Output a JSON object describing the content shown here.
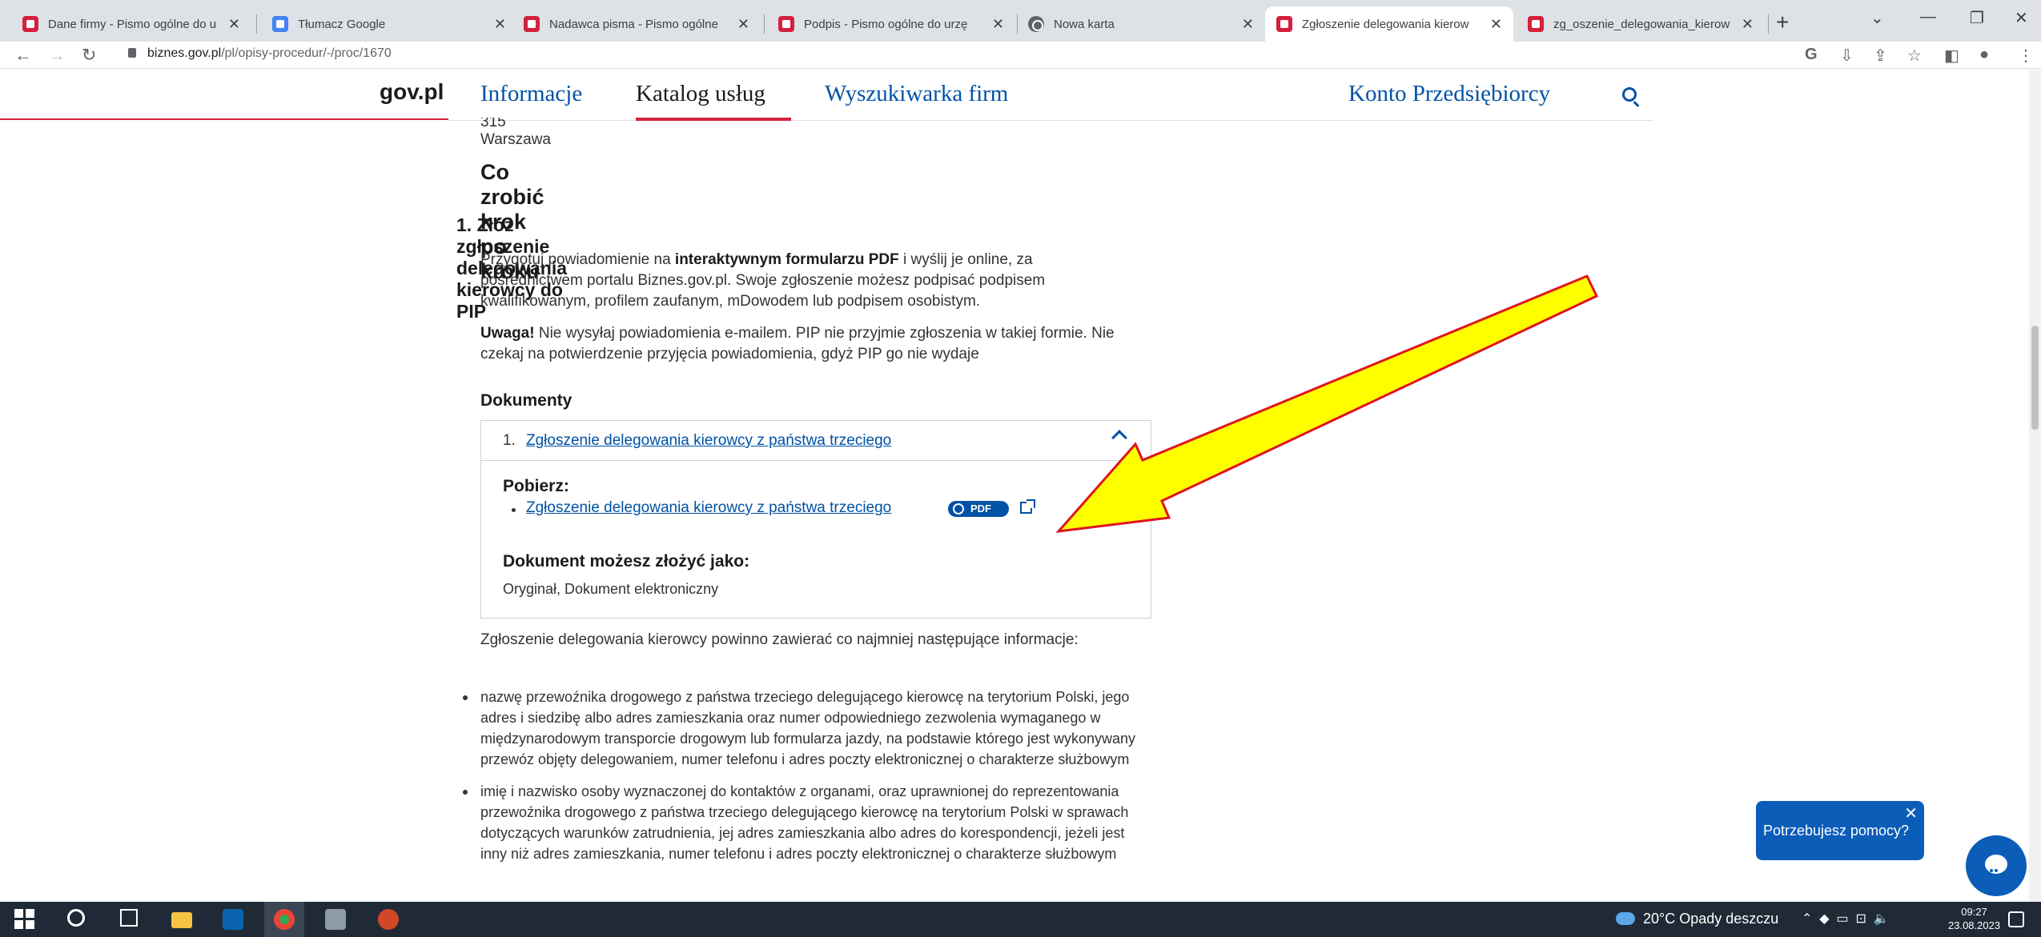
{
  "browser": {
    "tabs": [
      {
        "title": "Dane firmy - Pismo ogólne do u",
        "active": false
      },
      {
        "title": "Tłumacz Google",
        "active": false
      },
      {
        "title": "Nadawca pisma - Pismo ogólne",
        "active": false
      },
      {
        "title": "Podpis - Pismo ogólne do urzę",
        "active": false
      },
      {
        "title": "Nowa karta",
        "active": false
      },
      {
        "title": "Zgłoszenie delegowania kierow",
        "active": true
      },
      {
        "title": "zg_oszenie_delegowania_kierow",
        "active": false
      }
    ],
    "new_tab": "+",
    "close_glyph": "✕",
    "url_domain": "biznes.gov.pl",
    "url_path": "/pl/opisy-procedur/-/proc/1670"
  },
  "header": {
    "logo": "gov.pl",
    "menu": [
      "Informacje",
      "Katalog usług",
      "Wyszukiwarka firm"
    ],
    "account": "Konto Przedsiębiorcy"
  },
  "content": {
    "cut_address": "315 Warszawa",
    "section_title": "Co zrobić krok po kroku",
    "step_title": "1. Złóż zgłoszenie delegowania kierowcy do PIP",
    "p1_before": "Przygotuj powiadomienie na ",
    "p1_bold": "interaktywnym formularzu PDF",
    "p1_after": " i wyślij je online, za pośrednictwem portalu Biznes.gov.pl. Swoje zgłoszenie możesz podpisać podpisem kwalifikowanym, profilem zaufanym, mDowodem lub podpisem osobistym.",
    "p2_bold": "Uwaga!",
    "p2_after": " Nie wysyłaj powiadomienia e-mailem. PIP nie przyjmie zgłoszenia w takiej formie. Nie czekaj na potwierdzenie przyjęcia powiadomienia, gdyż PIP go nie wydaje",
    "docs_title": "Dokumenty",
    "doc": {
      "num": "1.",
      "title": "Zgłoszenie delegowania kierowcy z państwa trzeciego",
      "download_label": "Pobierz:",
      "download_link": "Zgłoszenie delegowania kierowcy z państwa trzeciego",
      "pdf_badge": "PDF",
      "submit_label": "Dokument możesz złożyć jako:",
      "submit_value": "Oryginał, Dokument elektroniczny"
    },
    "info_intro": "Zgłoszenie delegowania kierowcy powinno zawierać co najmniej następujące informacje:",
    "bullets": [
      "nazwę przewoźnika drogowego z państwa trzeciego delegującego kierowcę na terytorium Polski, jego adres i siedzibę albo adres zamieszkania oraz numer odpowiedniego zezwolenia wymaganego w międzynarodowym transporcie drogowym lub formularza jazdy, na podstawie którego jest wykonywany przewóz objęty delegowaniem, numer telefonu i adres poczty elektronicznej o charakterze służbowym",
      "imię i nazwisko osoby wyznaczonej do kontaktów z organami, oraz uprawnionej do reprezentowania przewoźnika drogowego z państwa trzeciego delegującego kierowcę na terytorium Polski w sprawach dotyczących warunków zatrudnienia, jej adres zamieszkania albo adres do korespondencji, jeżeli jest inny niż adres zamieszkania, numer telefonu i adres poczty elektronicznej o charakterze służbowym"
    ]
  },
  "help": {
    "bubble_text": "Potrzebujesz pomocy?",
    "close": "✕"
  },
  "taskbar": {
    "weather": "20°C  Opady deszczu",
    "time": "09:27",
    "date": "23.08.2023"
  },
  "colors": {
    "brand_red": "#d4213d",
    "link_blue": "#0052a5",
    "help_blue": "#0b5db8",
    "arrow_fill": "#ffff00",
    "arrow_stroke": "#e0141e"
  }
}
